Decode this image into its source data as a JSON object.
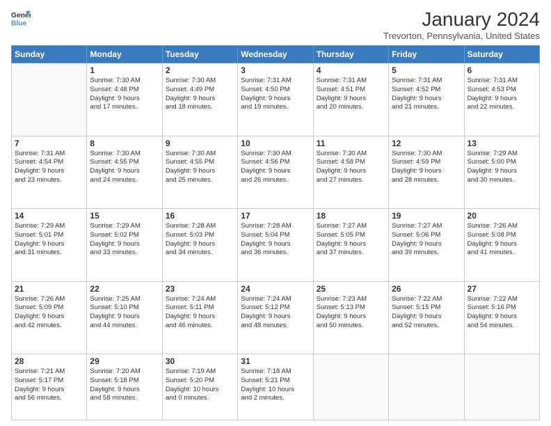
{
  "logo": {
    "line1": "General",
    "line2": "Blue"
  },
  "title": "January 2024",
  "location": "Trevorton, Pennsylvania, United States",
  "days_header": [
    "Sunday",
    "Monday",
    "Tuesday",
    "Wednesday",
    "Thursday",
    "Friday",
    "Saturday"
  ],
  "weeks": [
    [
      {
        "day": "",
        "content": ""
      },
      {
        "day": "1",
        "content": "Sunrise: 7:30 AM\nSunset: 4:48 PM\nDaylight: 9 hours\nand 17 minutes."
      },
      {
        "day": "2",
        "content": "Sunrise: 7:30 AM\nSunset: 4:49 PM\nDaylight: 9 hours\nand 18 minutes."
      },
      {
        "day": "3",
        "content": "Sunrise: 7:31 AM\nSunset: 4:50 PM\nDaylight: 9 hours\nand 19 minutes."
      },
      {
        "day": "4",
        "content": "Sunrise: 7:31 AM\nSunset: 4:51 PM\nDaylight: 9 hours\nand 20 minutes."
      },
      {
        "day": "5",
        "content": "Sunrise: 7:31 AM\nSunset: 4:52 PM\nDaylight: 9 hours\nand 21 minutes."
      },
      {
        "day": "6",
        "content": "Sunrise: 7:31 AM\nSunset: 4:53 PM\nDaylight: 9 hours\nand 22 minutes."
      }
    ],
    [
      {
        "day": "7",
        "content": "Sunrise: 7:31 AM\nSunset: 4:54 PM\nDaylight: 9 hours\nand 23 minutes."
      },
      {
        "day": "8",
        "content": "Sunrise: 7:30 AM\nSunset: 4:55 PM\nDaylight: 9 hours\nand 24 minutes."
      },
      {
        "day": "9",
        "content": "Sunrise: 7:30 AM\nSunset: 4:55 PM\nDaylight: 9 hours\nand 25 minutes."
      },
      {
        "day": "10",
        "content": "Sunrise: 7:30 AM\nSunset: 4:56 PM\nDaylight: 9 hours\nand 26 minutes."
      },
      {
        "day": "11",
        "content": "Sunrise: 7:30 AM\nSunset: 4:58 PM\nDaylight: 9 hours\nand 27 minutes."
      },
      {
        "day": "12",
        "content": "Sunrise: 7:30 AM\nSunset: 4:59 PM\nDaylight: 9 hours\nand 28 minutes."
      },
      {
        "day": "13",
        "content": "Sunrise: 7:29 AM\nSunset: 5:00 PM\nDaylight: 9 hours\nand 30 minutes."
      }
    ],
    [
      {
        "day": "14",
        "content": "Sunrise: 7:29 AM\nSunset: 5:01 PM\nDaylight: 9 hours\nand 31 minutes."
      },
      {
        "day": "15",
        "content": "Sunrise: 7:29 AM\nSunset: 5:02 PM\nDaylight: 9 hours\nand 33 minutes."
      },
      {
        "day": "16",
        "content": "Sunrise: 7:28 AM\nSunset: 5:03 PM\nDaylight: 9 hours\nand 34 minutes."
      },
      {
        "day": "17",
        "content": "Sunrise: 7:28 AM\nSunset: 5:04 PM\nDaylight: 9 hours\nand 36 minutes."
      },
      {
        "day": "18",
        "content": "Sunrise: 7:27 AM\nSunset: 5:05 PM\nDaylight: 9 hours\nand 37 minutes."
      },
      {
        "day": "19",
        "content": "Sunrise: 7:27 AM\nSunset: 5:06 PM\nDaylight: 9 hours\nand 39 minutes."
      },
      {
        "day": "20",
        "content": "Sunrise: 7:26 AM\nSunset: 5:08 PM\nDaylight: 9 hours\nand 41 minutes."
      }
    ],
    [
      {
        "day": "21",
        "content": "Sunrise: 7:26 AM\nSunset: 5:09 PM\nDaylight: 9 hours\nand 42 minutes."
      },
      {
        "day": "22",
        "content": "Sunrise: 7:25 AM\nSunset: 5:10 PM\nDaylight: 9 hours\nand 44 minutes."
      },
      {
        "day": "23",
        "content": "Sunrise: 7:24 AM\nSunset: 5:11 PM\nDaylight: 9 hours\nand 46 minutes."
      },
      {
        "day": "24",
        "content": "Sunrise: 7:24 AM\nSunset: 5:12 PM\nDaylight: 9 hours\nand 48 minutes."
      },
      {
        "day": "25",
        "content": "Sunrise: 7:23 AM\nSunset: 5:13 PM\nDaylight: 9 hours\nand 50 minutes."
      },
      {
        "day": "26",
        "content": "Sunrise: 7:22 AM\nSunset: 5:15 PM\nDaylight: 9 hours\nand 52 minutes."
      },
      {
        "day": "27",
        "content": "Sunrise: 7:22 AM\nSunset: 5:16 PM\nDaylight: 9 hours\nand 54 minutes."
      }
    ],
    [
      {
        "day": "28",
        "content": "Sunrise: 7:21 AM\nSunset: 5:17 PM\nDaylight: 9 hours\nand 56 minutes."
      },
      {
        "day": "29",
        "content": "Sunrise: 7:20 AM\nSunset: 5:18 PM\nDaylight: 9 hours\nand 58 minutes."
      },
      {
        "day": "30",
        "content": "Sunrise: 7:19 AM\nSunset: 5:20 PM\nDaylight: 10 hours\nand 0 minutes."
      },
      {
        "day": "31",
        "content": "Sunrise: 7:18 AM\nSunset: 5:21 PM\nDaylight: 10 hours\nand 2 minutes."
      },
      {
        "day": "",
        "content": ""
      },
      {
        "day": "",
        "content": ""
      },
      {
        "day": "",
        "content": ""
      }
    ]
  ]
}
